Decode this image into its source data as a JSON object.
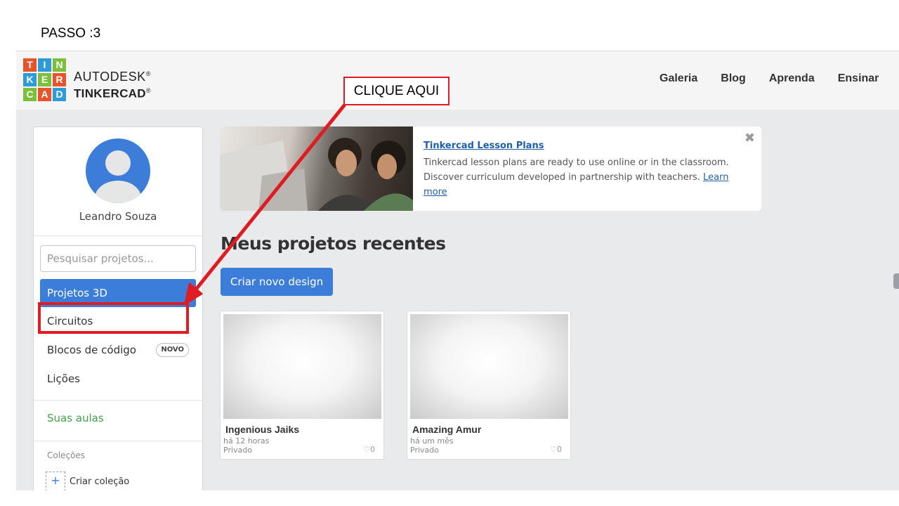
{
  "step_label": "PASSO :3",
  "callout": {
    "text": "CLIQUE AQUI"
  },
  "logo": {
    "letters": [
      "T",
      "I",
      "N",
      "K",
      "E",
      "R",
      "C",
      "A",
      "D"
    ],
    "colors": [
      "#e8542a",
      "#2f9ad8",
      "#7bbf3a",
      "#2f9ad8",
      "#7bbf3a",
      "#e8542a",
      "#7bbf3a",
      "#e8542a",
      "#2f9ad8"
    ]
  },
  "brand": {
    "line1": "AUTODESK",
    "line2": "TINKERCAD",
    "mark": "®"
  },
  "nav": {
    "links": [
      "Galeria",
      "Blog",
      "Aprenda",
      "Ensinar"
    ]
  },
  "sidebar": {
    "username": "Leandro Souza",
    "search_placeholder": "Pesquisar projetos...",
    "items": [
      {
        "label": "Projetos 3D",
        "active": true
      },
      {
        "label": "Circuitos"
      },
      {
        "label": "Blocos de código",
        "badge": "NOVO"
      },
      {
        "label": "Lições"
      }
    ],
    "classes_label": "Suas aulas",
    "collections_label": "Coleções",
    "create_collection": "Criar coleção",
    "plus": "+"
  },
  "banner": {
    "title": "Tinkercad Lesson Plans",
    "text": "Tinkercad lesson plans are ready to use online or in the classroom. Discover curriculum developed in partnership with teachers.",
    "link": "Learn more",
    "close": "✖"
  },
  "main": {
    "section_title": "Meus projetos recentes",
    "create_button": "Criar novo design",
    "projects": [
      {
        "name": "Ingenious Jaiks",
        "time": "há 12 horas",
        "privacy": "Privado",
        "likes": "♡0"
      },
      {
        "name": "Amazing Amur",
        "time": "há um mês",
        "privacy": "Privado",
        "likes": "♡0"
      }
    ]
  },
  "colors": {
    "accent": "#3b7dd8",
    "annotation_red": "#e11b22",
    "green": "#3ea34a"
  }
}
